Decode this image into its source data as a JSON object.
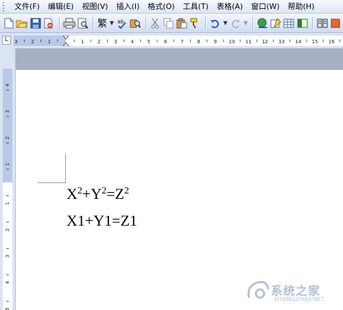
{
  "menu": {
    "items": [
      "文件(F)",
      "编辑(E)",
      "视图(V)",
      "插入(I)",
      "格式(O)",
      "工具(T)",
      "表格(A)",
      "窗口(W)",
      "帮助(H)"
    ]
  },
  "toolbar": {
    "traditional_chinese_label": "繁",
    "icons": [
      "new-document-icon",
      "open-icon",
      "save-icon",
      "permission-icon",
      "print-icon",
      "print-preview-icon",
      "traditional-chinese-icon",
      "spelling-icon",
      "research-icon",
      "cut-icon",
      "copy-icon",
      "paste-icon",
      "format-painter-icon",
      "undo-icon",
      "redo-icon",
      "hyperlink-icon",
      "tables-borders-icon",
      "insert-table-icon",
      "insert-excel-icon",
      "columns-icon"
    ]
  },
  "ruler": {
    "horizontal_labels": [
      "3",
      "2",
      "1",
      "1",
      "2",
      "3",
      "4",
      "5",
      "6",
      "7",
      "8",
      "9",
      "10",
      "11",
      "12",
      "13",
      "14",
      "15",
      "16"
    ],
    "vertical_labels": [
      "4",
      "3",
      "2",
      "1",
      "1",
      "2",
      "3",
      "4",
      "5"
    ],
    "corner_symbol": "L"
  },
  "document": {
    "line1": {
      "x": "X",
      "y": "Y",
      "z": "Z",
      "exp": "2",
      "plus": "+",
      "eq": "="
    },
    "line2": "X1+Y1=Z1"
  },
  "watermark": {
    "text": "系统之家",
    "sub": "XITONGZHIJIA.NET"
  },
  "colors": {
    "menubar": "#dbe5f5",
    "ruler_margin": "#b8c8e6",
    "gray_band": "#a7b0c3",
    "watermark": "#6f8fb8"
  }
}
